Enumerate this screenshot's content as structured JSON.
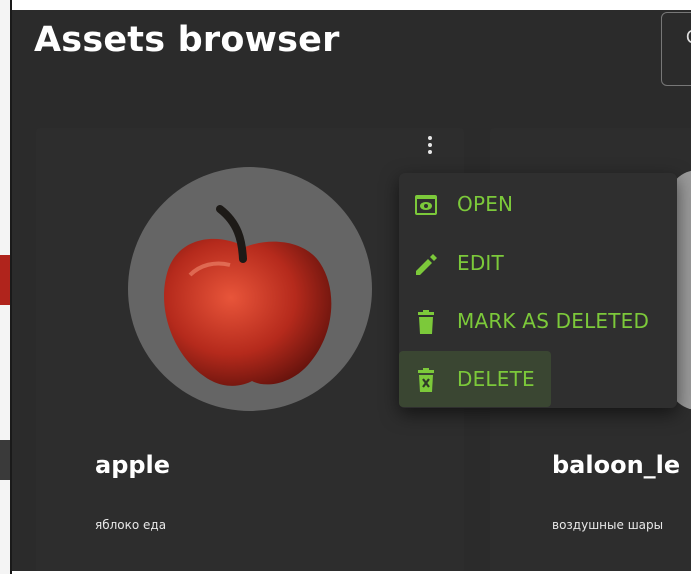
{
  "page": {
    "title": "Assets browser"
  },
  "assets": [
    {
      "name": "apple",
      "description": "яблоко еда",
      "thumbnail_icon": "apple-thumbnail"
    },
    {
      "name": "baloon_le",
      "description": "воздушные шары",
      "thumbnail_icon": "balloon-thumbnail"
    }
  ],
  "context_menu": {
    "open_label": "OPEN",
    "edit_label": "EDIT",
    "mark_deleted_label": "MARK AS DELETED",
    "delete_label": "DELETE",
    "open_icon": "preview-icon",
    "edit_icon": "pencil-icon",
    "mark_deleted_icon": "trash-icon",
    "delete_icon": "trash-x-icon",
    "highlighted_item": "DELETE"
  },
  "colors": {
    "background": "#2b2b2b",
    "card": "#2d2d2d",
    "accent": "#7cc93a",
    "menu": "#2f2f2f"
  }
}
